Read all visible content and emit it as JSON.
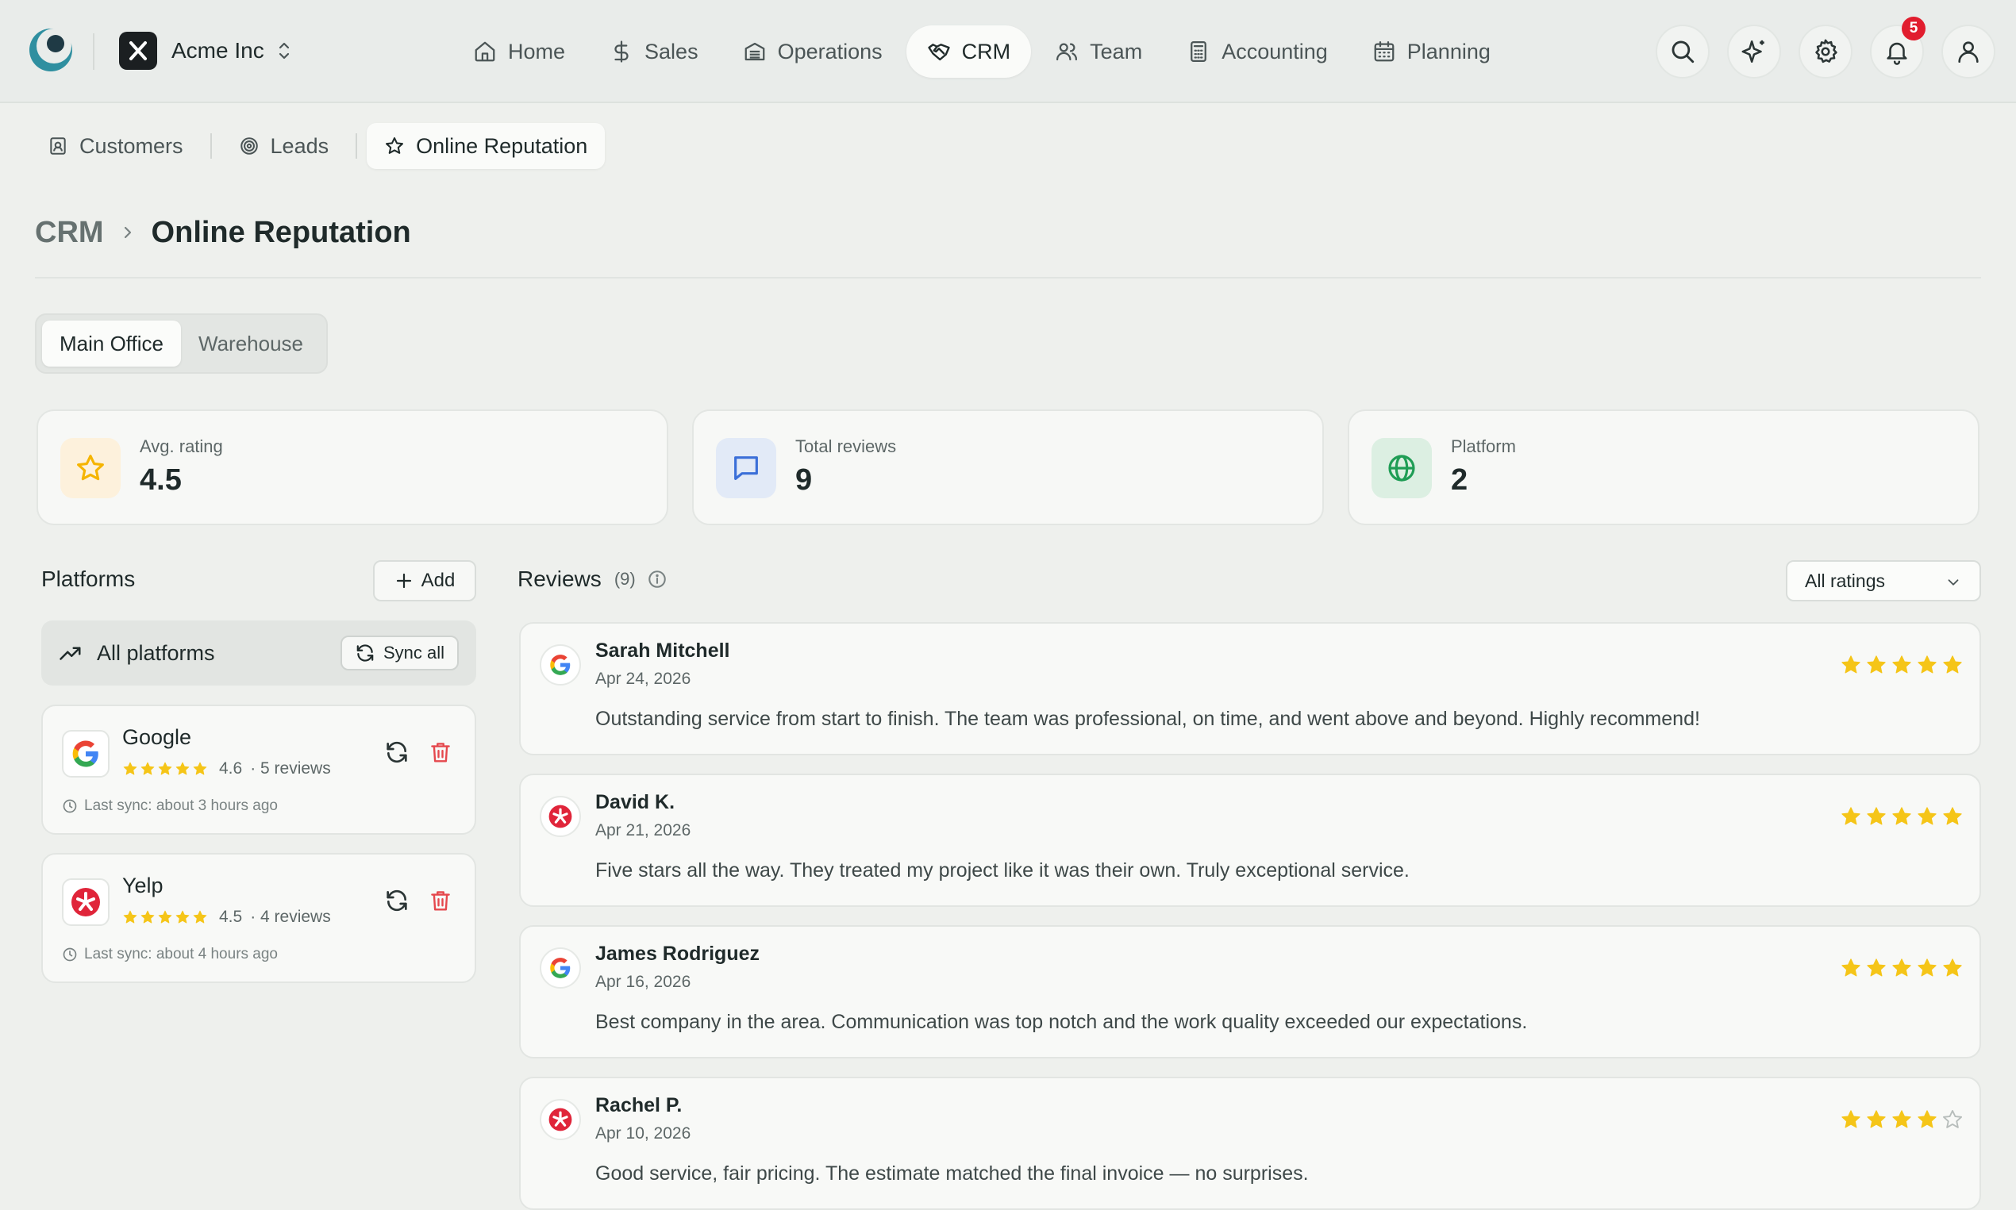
{
  "app": {
    "org_name": "Acme Inc",
    "notification_count": "5"
  },
  "nav": [
    {
      "label": "Home",
      "icon": "home-icon"
    },
    {
      "label": "Sales",
      "icon": "dollar-icon"
    },
    {
      "label": "Operations",
      "icon": "building-icon"
    },
    {
      "label": "CRM",
      "icon": "handshake-icon",
      "active": true
    },
    {
      "label": "Team",
      "icon": "users-icon"
    },
    {
      "label": "Accounting",
      "icon": "calculator-icon"
    },
    {
      "label": "Planning",
      "icon": "calendar-icon"
    }
  ],
  "subnav": [
    {
      "label": "Customers",
      "icon": "contact-icon"
    },
    {
      "label": "Leads",
      "icon": "target-icon"
    },
    {
      "label": "Online Reputation",
      "icon": "star-icon",
      "active": true
    }
  ],
  "breadcrumb": {
    "root": "CRM",
    "current": "Online Reputation"
  },
  "locations": [
    {
      "label": "Main Office",
      "active": true
    },
    {
      "label": "Warehouse"
    }
  ],
  "stats": [
    {
      "label": "Avg. rating",
      "value": "4.5",
      "icon": "star-icon",
      "color": "#f5b400"
    },
    {
      "label": "Total reviews",
      "value": "9",
      "icon": "message-icon",
      "color": "#3b6fd8"
    },
    {
      "label": "Platform",
      "value": "2",
      "icon": "globe-icon",
      "color": "#1f9d55"
    }
  ],
  "platforms_panel": {
    "title": "Platforms",
    "add_label": "Add",
    "all_label": "All platforms",
    "sync_all_label": "Sync all",
    "items": [
      {
        "name": "Google",
        "rating": "4.6",
        "reviews": "· 5 reviews",
        "stars": 5,
        "last_sync": "Last sync: about 3 hours ago",
        "logo": "google-logo"
      },
      {
        "name": "Yelp",
        "rating": "4.5",
        "reviews": "· 4 reviews",
        "stars": 5,
        "last_sync": "Last sync: about 4 hours ago",
        "logo": "yelp-logo"
      }
    ]
  },
  "reviews_panel": {
    "title": "Reviews",
    "count": "(9)",
    "filter": "All ratings",
    "items": [
      {
        "name": "Sarah Mitchell",
        "date": "Apr 24, 2026",
        "text": "Outstanding service from start to finish. The team was professional, on time, and went above and beyond. Highly recommend!",
        "stars": 5,
        "platform": "google"
      },
      {
        "name": "David K.",
        "date": "Apr 21, 2026",
        "text": "Five stars all the way. They treated my project like it was their own. Truly exceptional service.",
        "stars": 5,
        "platform": "yelp"
      },
      {
        "name": "James Rodriguez",
        "date": "Apr 16, 2026",
        "text": "Best company in the area. Communication was top notch and the work quality exceeded our expectations.",
        "stars": 5,
        "platform": "google"
      },
      {
        "name": "Rachel P.",
        "date": "Apr 10, 2026",
        "text": "Good service, fair pricing. The estimate matched the final invoice — no surprises.",
        "stars": 4,
        "platform": "yelp"
      }
    ]
  },
  "colors": {
    "accent_star": "#f5c518",
    "danger": "#e5484d",
    "brand_teal": "#1f6f7a"
  }
}
